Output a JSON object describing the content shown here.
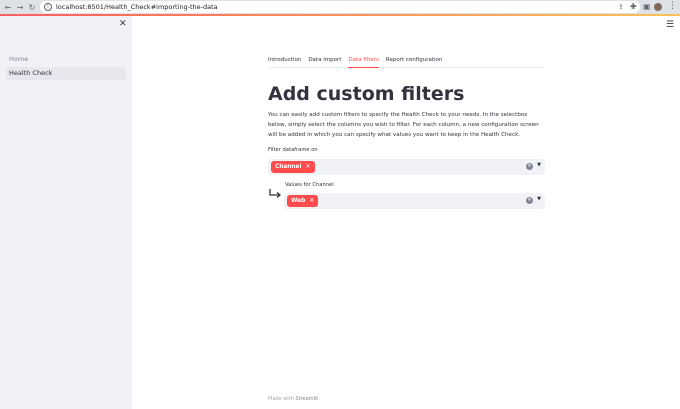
{
  "browser": {
    "url": "localhost:8501/Health_Check#importing-the-data"
  },
  "sidebar": {
    "items": [
      {
        "label": "Home"
      },
      {
        "label": "Health Check"
      }
    ]
  },
  "tabs": [
    {
      "label": "Introduction"
    },
    {
      "label": "Data import"
    },
    {
      "label": "Data filters"
    },
    {
      "label": "Report configuration"
    }
  ],
  "page": {
    "title": "Add custom filters",
    "description": "You can easily add custom filters to specify the Health Check to your needs. In the selectbox below, simply select the columns you wish to filter. For each column, a new configuration screen will be added in which you can specify what values you want to keep in the Health Check."
  },
  "filters": {
    "dataframe_label": "Filter dataframe on",
    "dataframe_selected": "Channel",
    "values_label": "Values for Channel",
    "values_selected": "Web"
  },
  "footer": {
    "prefix": "Made with",
    "brand": "Streamlit"
  },
  "colors": {
    "accent": "#ff4b4b",
    "sidebar_bg": "#f0f2f6",
    "text": "#31333f"
  }
}
